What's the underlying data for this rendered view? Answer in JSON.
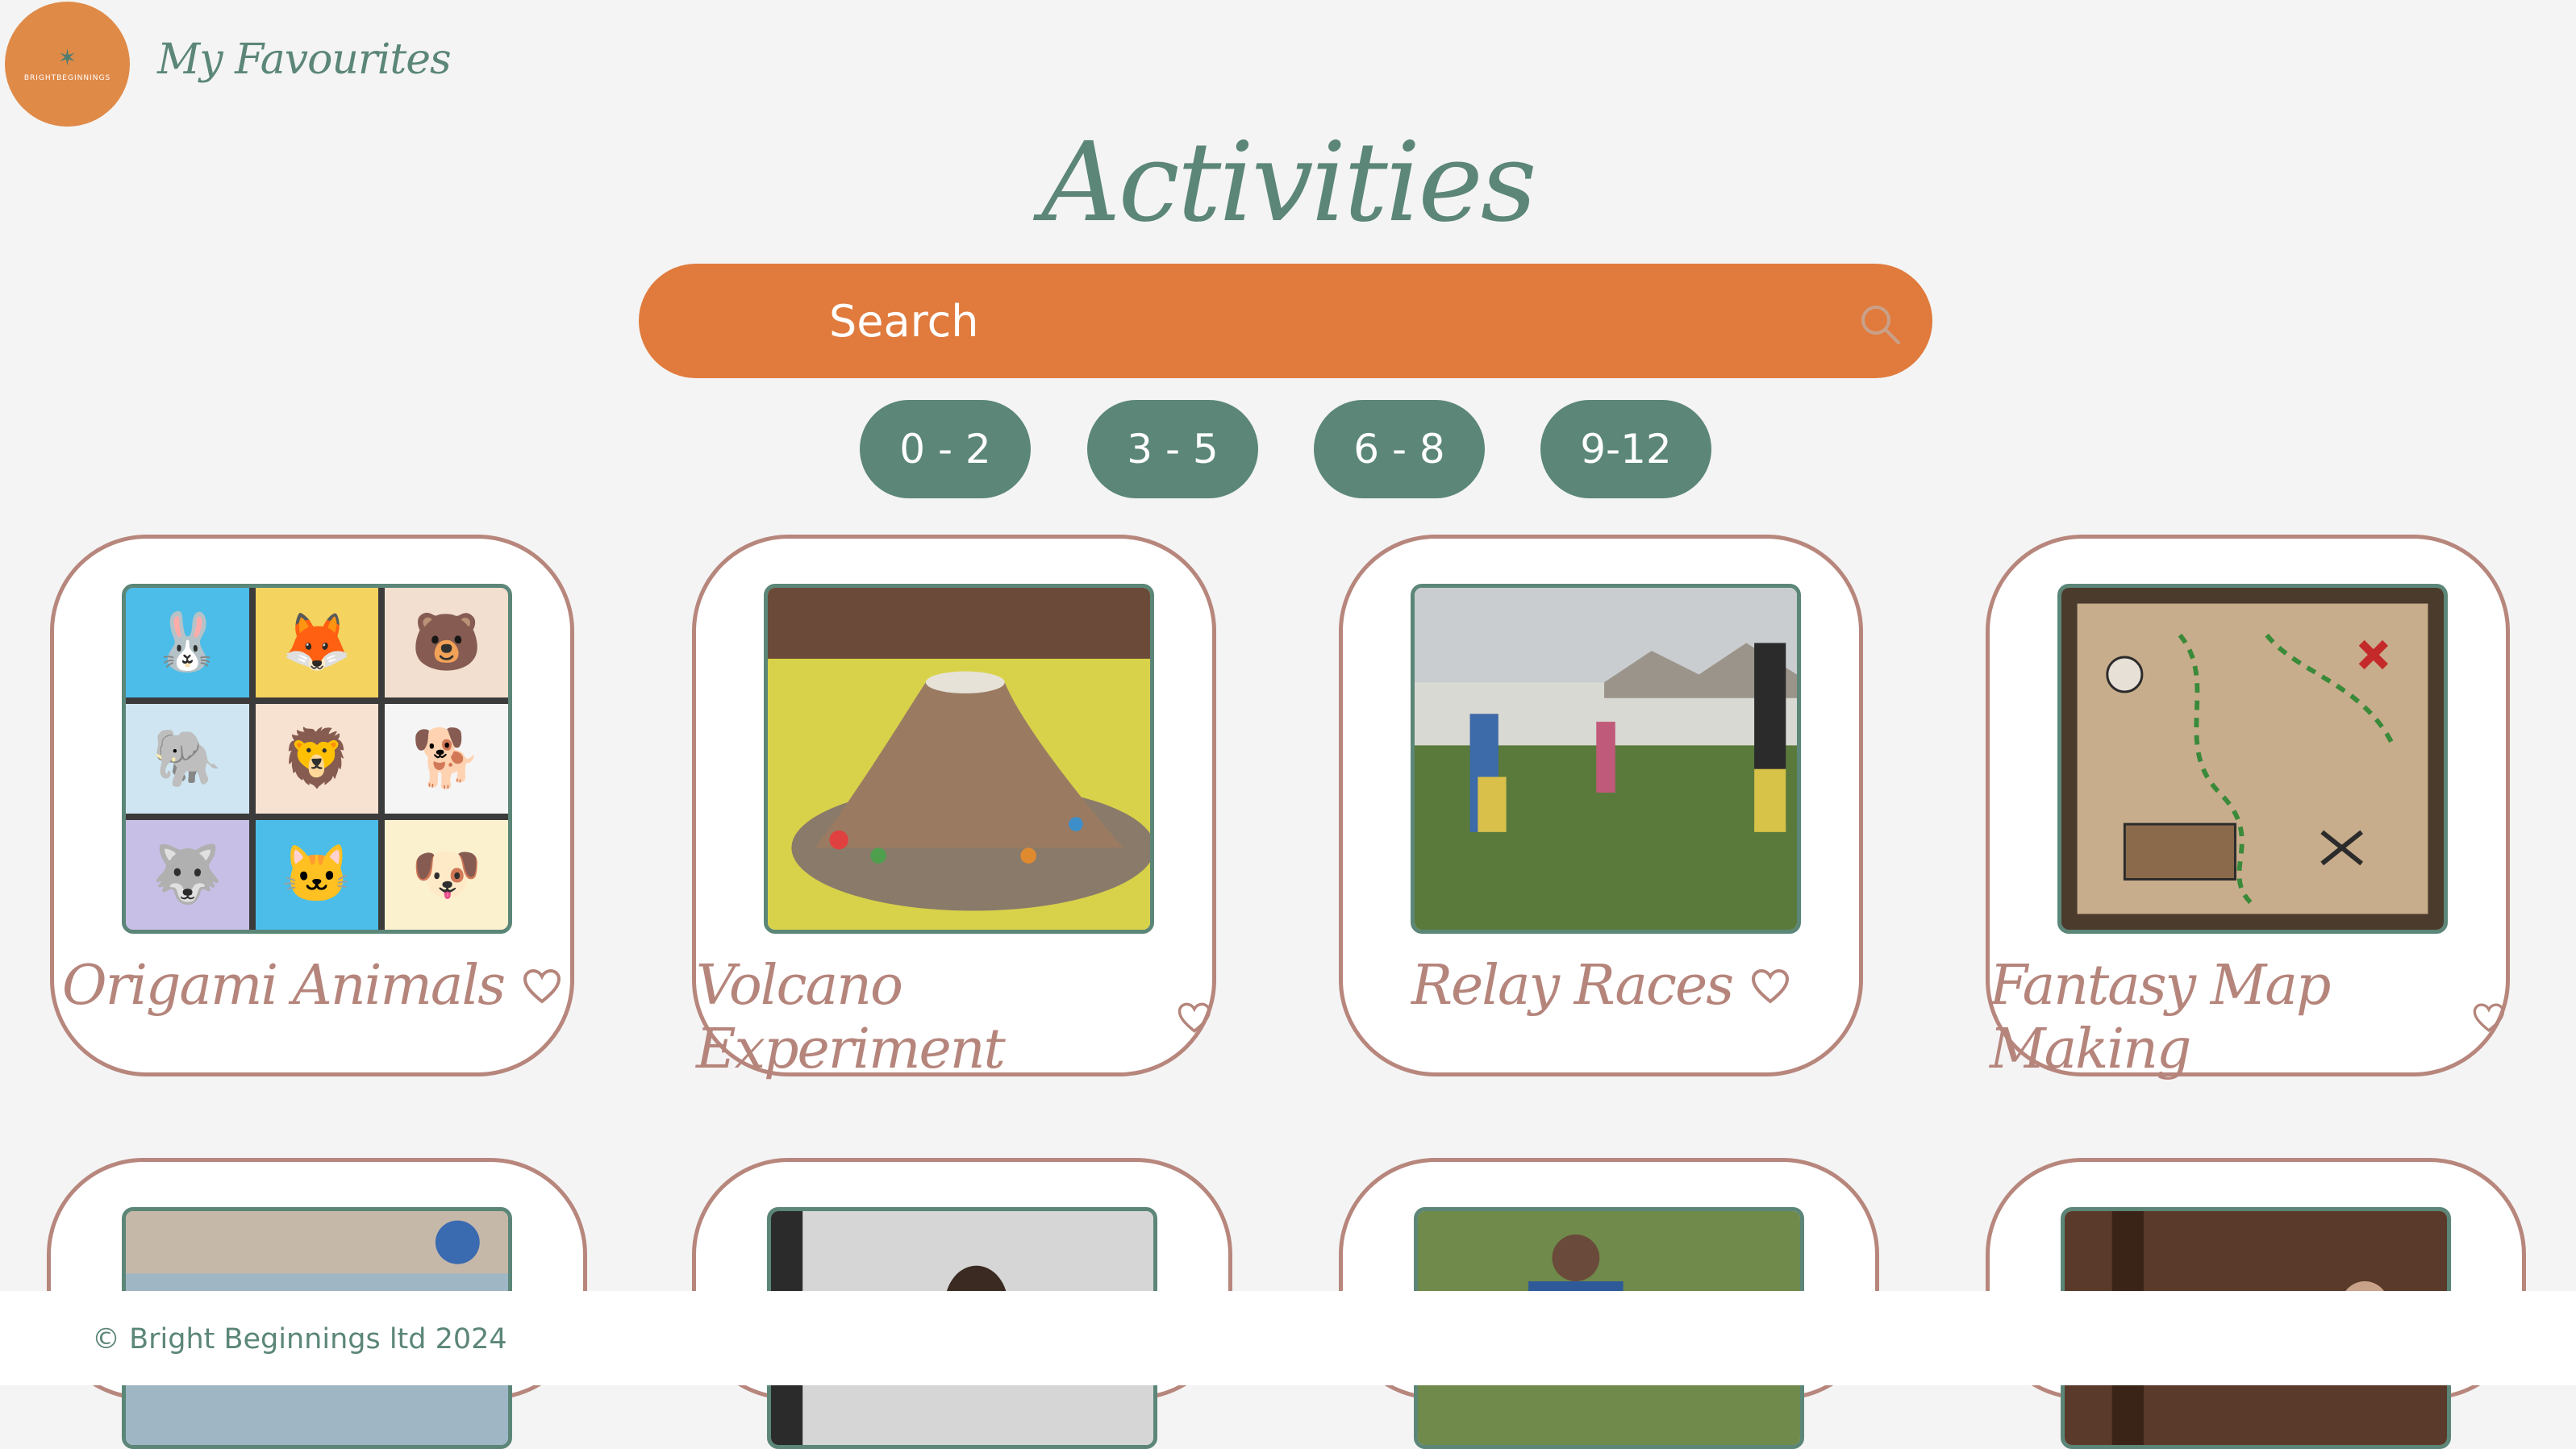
{
  "header": {
    "logo_text": "BRIGHTBEGINNINGS",
    "favourites_label": "My Favourites"
  },
  "page": {
    "title": "Activities"
  },
  "search": {
    "placeholder": "Search"
  },
  "age_filters": [
    {
      "label": "0 - 2"
    },
    {
      "label": "3 - 5"
    },
    {
      "label": "6 - 8"
    },
    {
      "label": "9-12"
    }
  ],
  "activities": [
    {
      "title": "Origami Animals",
      "image": "origami-animals-image"
    },
    {
      "title": "Volcano Experiment",
      "image": "volcano-experiment-image"
    },
    {
      "title": "Relay Races",
      "image": "relay-races-image"
    },
    {
      "title": "Fantasy Map Making",
      "image": "fantasy-map-image"
    }
  ],
  "footer": {
    "copyright": "© Bright Beginnings ltd 2024"
  },
  "colors": {
    "background": "#f4f4f4",
    "accent_orange": "#e07b3d",
    "accent_green": "#5b8678",
    "card_border": "#b7867c",
    "card_title": "#b5857c"
  },
  "icons": {
    "search": "search-icon",
    "favourite": "heart-icon"
  }
}
